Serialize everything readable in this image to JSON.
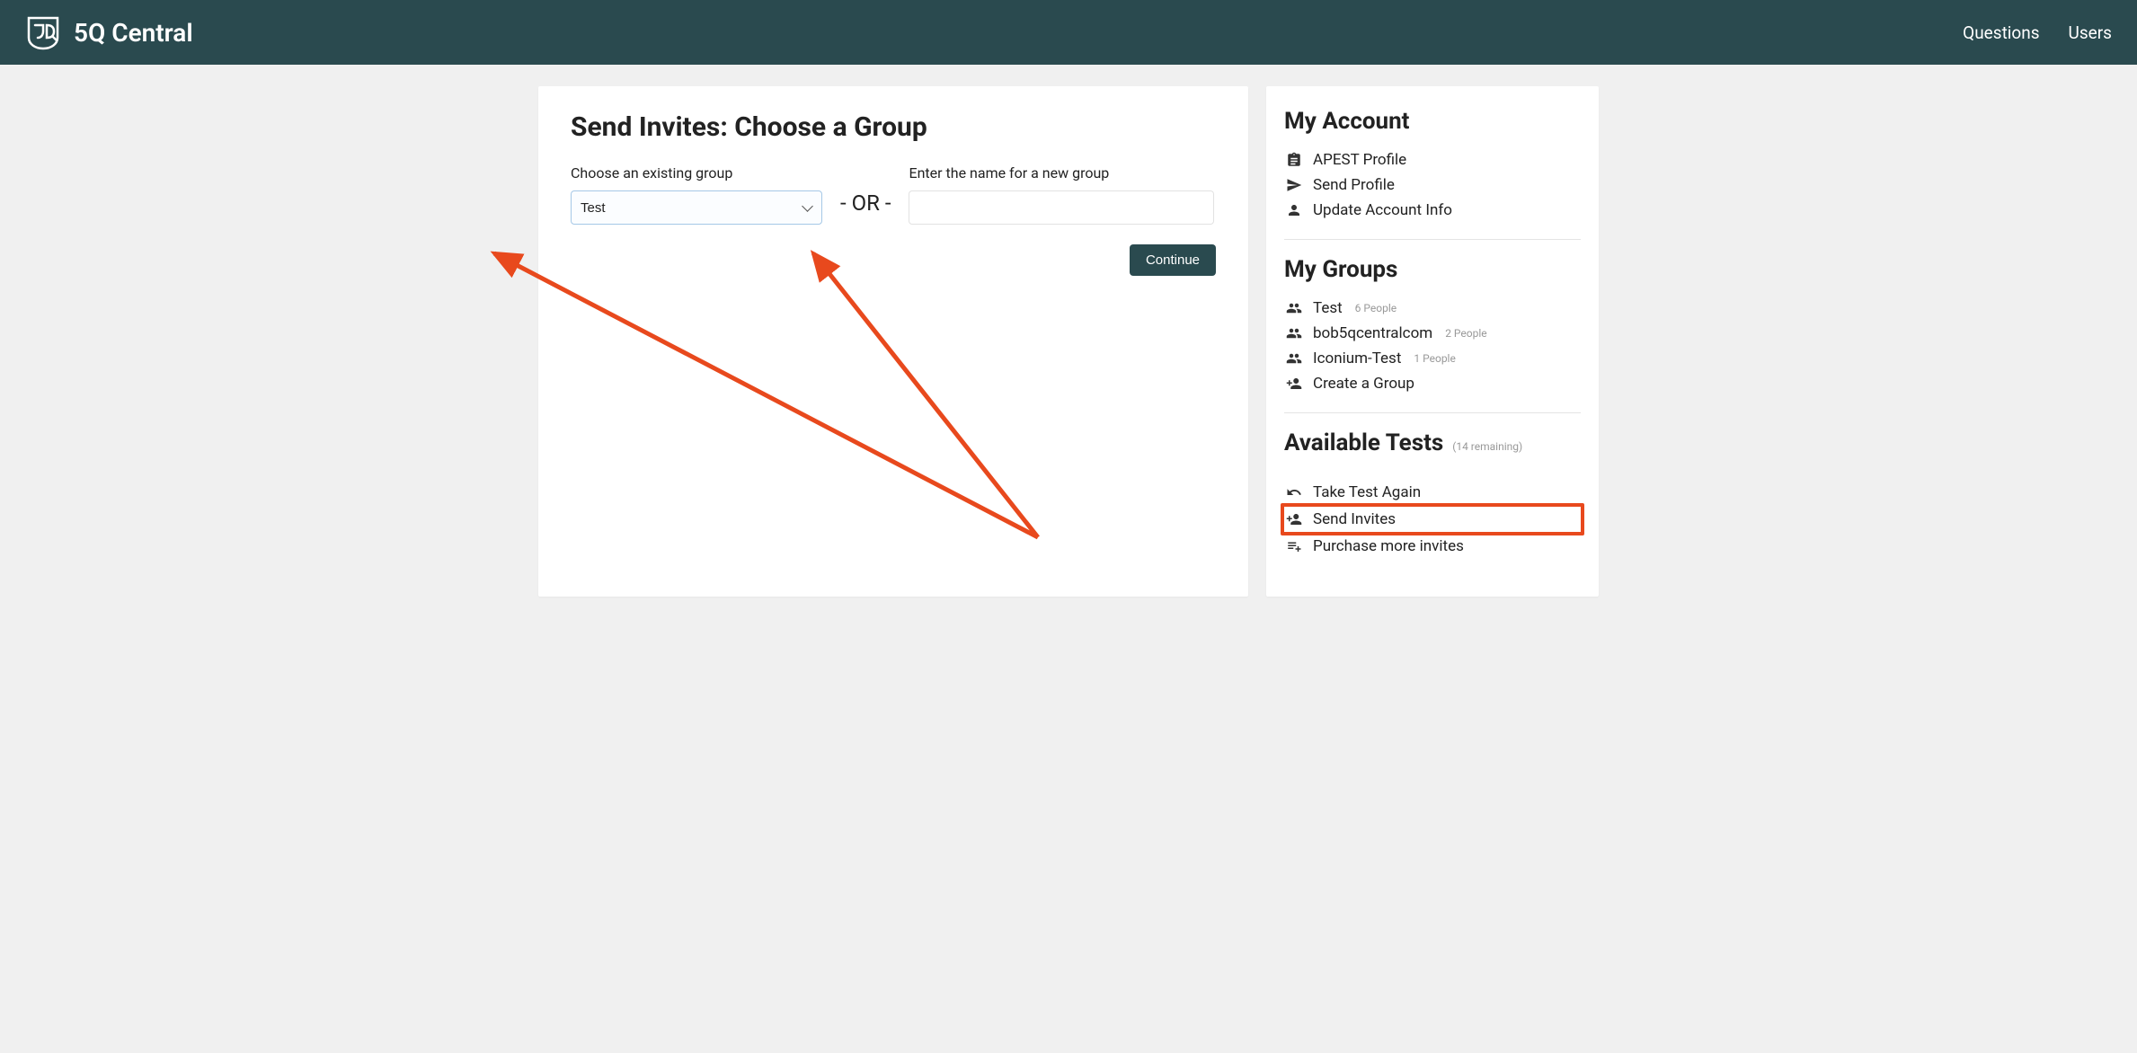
{
  "header": {
    "brand": "5Q Central",
    "nav": {
      "questions": "Questions",
      "users": "Users"
    }
  },
  "main": {
    "title": "Send Invites: Choose a Group",
    "existing_label": "Choose an existing group",
    "existing_selected": "Test",
    "or_label": "- OR -",
    "new_label": "Enter the name for a new group",
    "new_value": "",
    "continue_label": "Continue"
  },
  "sidebar": {
    "account": {
      "title": "My Account",
      "items": {
        "profile": "APEST Profile",
        "send": "Send Profile",
        "update": "Update Account Info"
      }
    },
    "groups": {
      "title": "My Groups",
      "items": [
        {
          "name": "Test",
          "meta": "6 People"
        },
        {
          "name": "bob5qcentralcom",
          "meta": "2 People"
        },
        {
          "name": "Iconium-Test",
          "meta": "1 People"
        }
      ],
      "create": "Create a Group"
    },
    "tests": {
      "title": "Available Tests",
      "meta": "(14 remaining)",
      "items": {
        "take": "Take Test Again",
        "send": "Send Invites",
        "purchase": "Purchase more invites"
      }
    }
  }
}
